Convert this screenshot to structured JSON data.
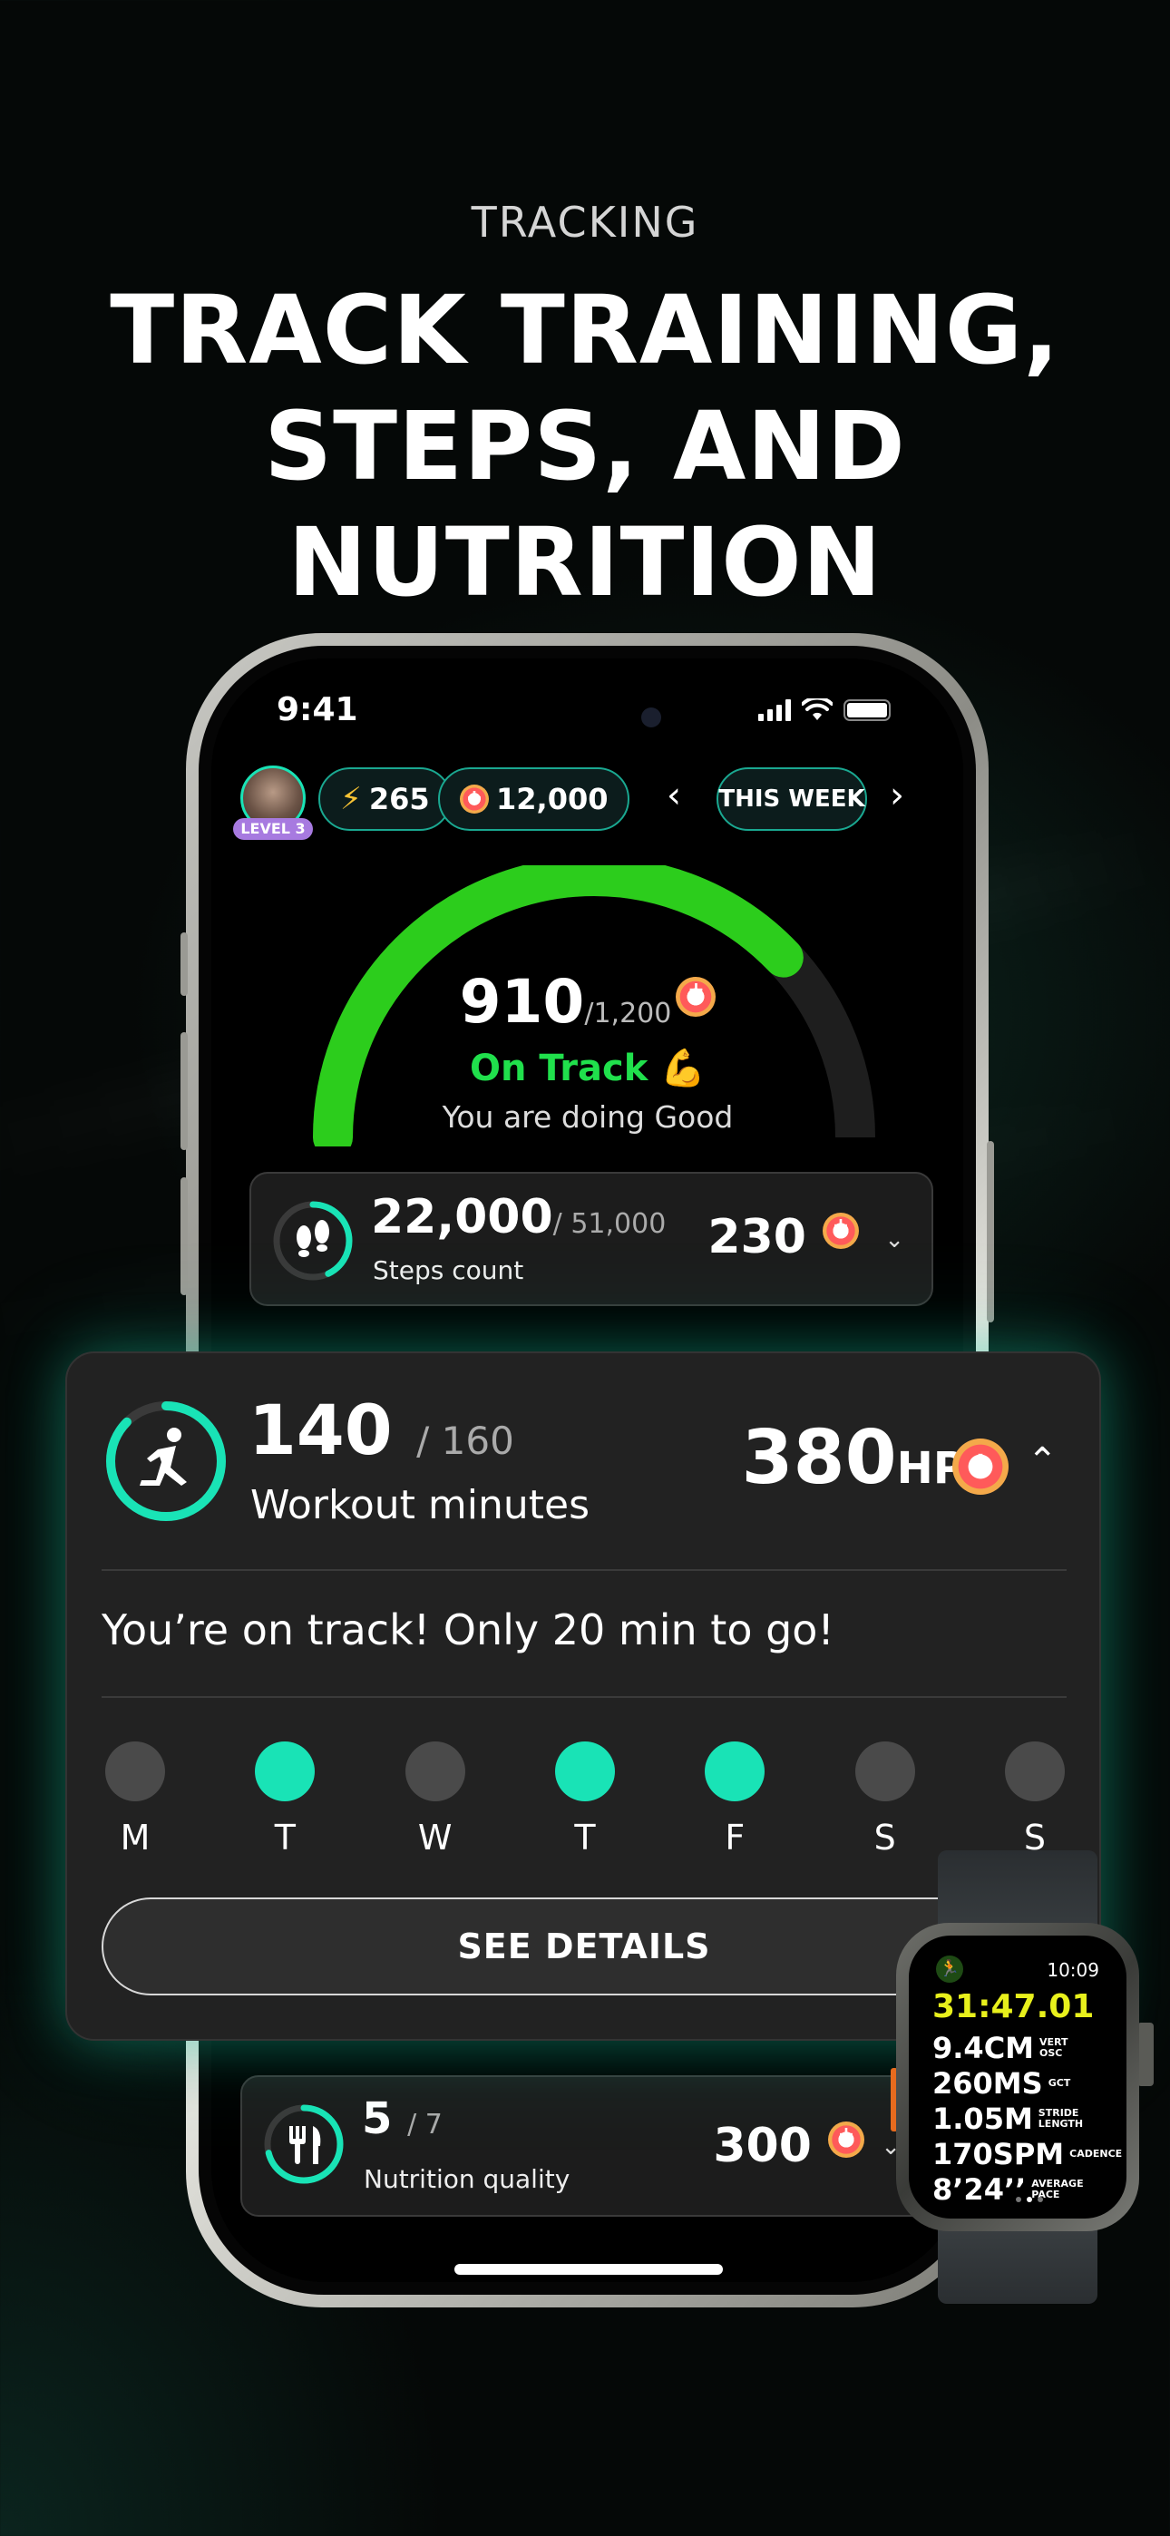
{
  "eyebrow": "TRACKING",
  "headline": [
    "TRACK TRAINING,",
    "STEPS, AND NUTRITION"
  ],
  "phone": {
    "status": {
      "time": "9:41"
    },
    "profile": {
      "level": "LEVEL 3"
    },
    "chips": {
      "energy": "265",
      "points": "12,000"
    },
    "period": {
      "label": "THIS WEEK",
      "prev": "‹",
      "next": "›"
    },
    "gauge": {
      "value": "910",
      "target": "/1,200",
      "progress": 0.758,
      "status": "On Track 💪",
      "message": "You are doing Good"
    },
    "steps": {
      "value": "22,000",
      "target": "/ 51,000",
      "label": "Steps count",
      "points": "230",
      "progress": 0.43
    },
    "nutrition": {
      "value": "5",
      "target": "/ 7",
      "label": "Nutrition quality",
      "points": "300",
      "progress": 0.71
    }
  },
  "workout": {
    "value": "140",
    "target": "/ 160",
    "label": "Workout minutes",
    "points": "380",
    "points_unit": "HP",
    "progress": 0.875,
    "message": "You’re on track! Only 20 min to go!",
    "days": [
      {
        "label": "M",
        "done": false
      },
      {
        "label": "T",
        "done": true
      },
      {
        "label": "W",
        "done": false
      },
      {
        "label": "T",
        "done": true
      },
      {
        "label": "F",
        "done": true
      },
      {
        "label": "S",
        "done": false
      },
      {
        "label": "S",
        "done": false
      }
    ],
    "button": "SEE DETAILS"
  },
  "watch": {
    "time": "10:09",
    "elapsed": "31:47.01",
    "metrics": [
      {
        "value": "9.4CM",
        "unit": "VERT\nOSC"
      },
      {
        "value": "260MS",
        "unit": "GCT"
      },
      {
        "value": "1.05M",
        "unit": "STRIDE\nLENGTH"
      },
      {
        "value": "170SPM",
        "unit": "CADENCE"
      },
      {
        "value": "8’24’’",
        "unit": "AVERAGE\nPACE"
      }
    ]
  },
  "colors": {
    "accent": "#19e3b6",
    "green": "#2ccd1c",
    "on_track": "#20e04c",
    "watch_yellow": "#e8f01c"
  }
}
